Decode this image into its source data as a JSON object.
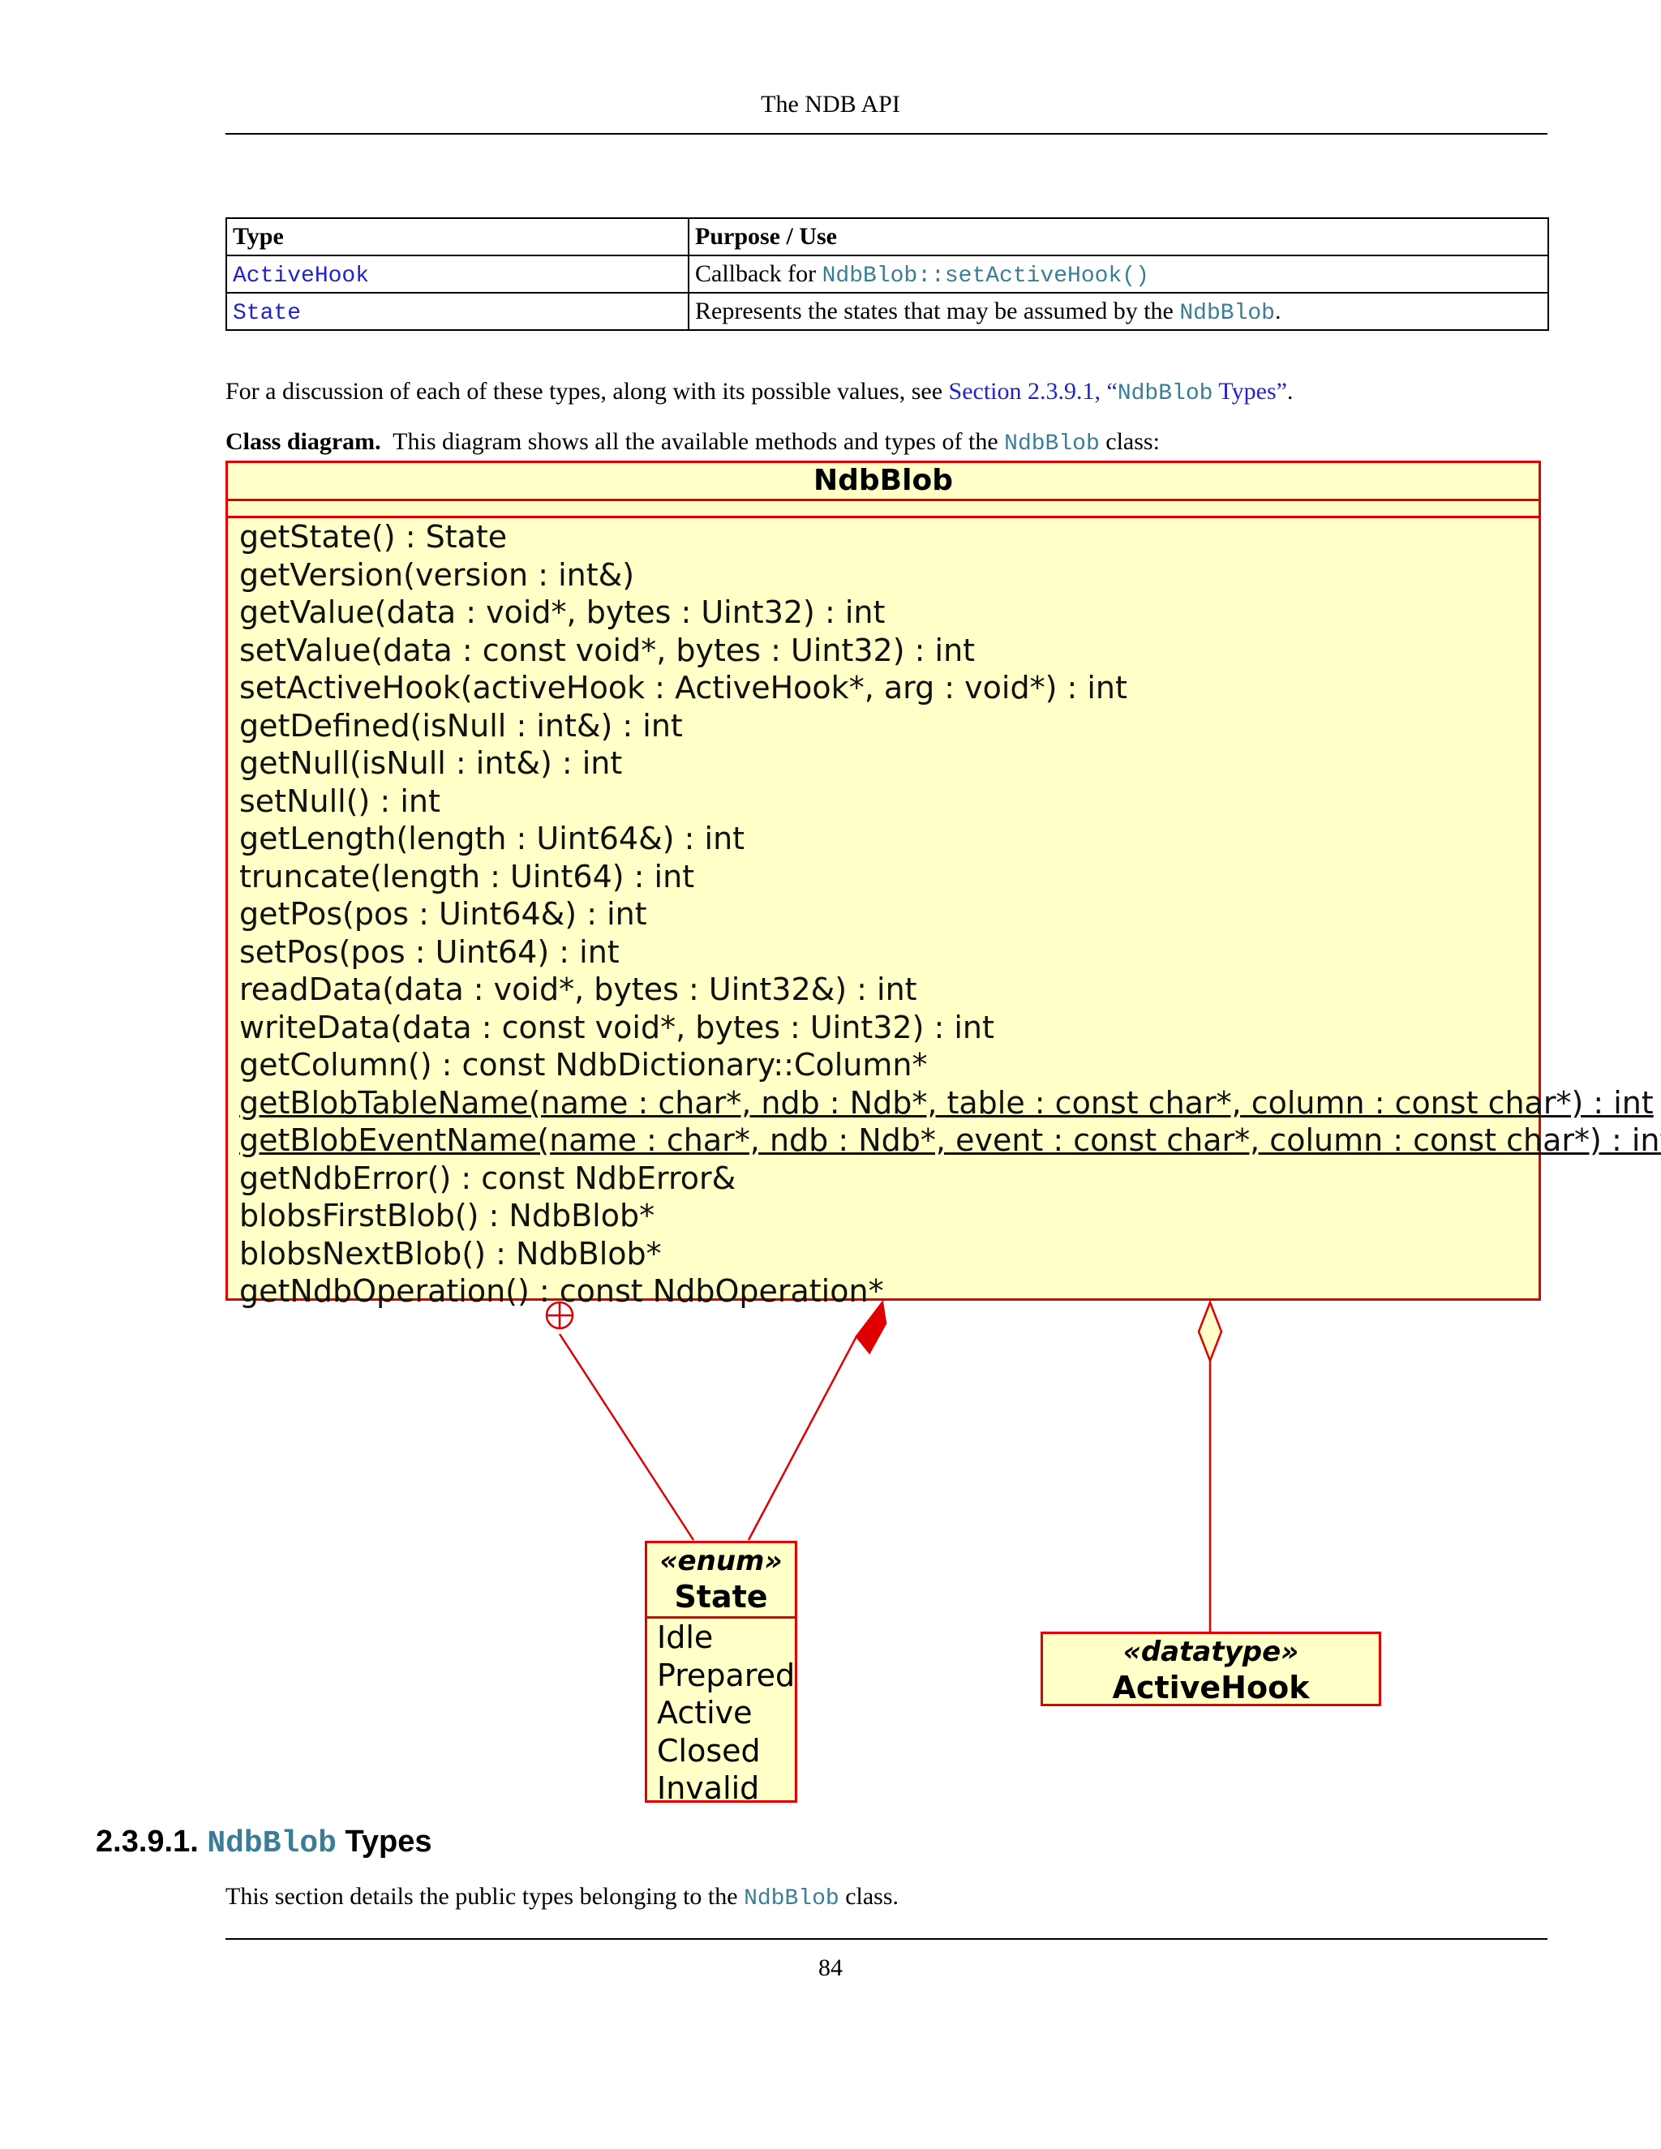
{
  "header": {
    "title": "The NDB API"
  },
  "types_table": {
    "headers": [
      "Type",
      "Purpose / Use"
    ],
    "rows": [
      {
        "type": "ActiveHook",
        "purpose_text": "Callback for ",
        "purpose_code": "NdbBlob::setActiveHook()",
        "purpose_tail": ""
      },
      {
        "type": "State",
        "purpose_text": "Represents the states that may be assumed by the ",
        "purpose_code": "NdbBlob",
        "purpose_tail": "."
      }
    ]
  },
  "discussion": {
    "text_before": "For a discussion of each of these types, along with its possible values, see ",
    "link_section": "Section 2.3.9.1, “",
    "link_code": "NdbBlob",
    "link_end": " Types”",
    "text_after": "."
  },
  "class_diagram_caption": {
    "label": "Class diagram.",
    "text": "This diagram shows all the available methods and types of the ",
    "code": "NdbBlob",
    "tail": " class:"
  },
  "uml": {
    "class_name": "NdbBlob",
    "methods": [
      {
        "text": "getState() : State",
        "static": false
      },
      {
        "text": "getVersion(version : int&)",
        "static": false
      },
      {
        "text": "getValue(data : void*, bytes : Uint32) : int",
        "static": false
      },
      {
        "text": "setValue(data : const void*, bytes : Uint32) : int",
        "static": false
      },
      {
        "text": "setActiveHook(activeHook : ActiveHook*, arg : void*) : int",
        "static": false
      },
      {
        "text": "getDefined(isNull : int&) : int",
        "static": false
      },
      {
        "text": "getNull(isNull : int&) : int",
        "static": false
      },
      {
        "text": "setNull() : int",
        "static": false
      },
      {
        "text": "getLength(length : Uint64&) : int",
        "static": false
      },
      {
        "text": "truncate(length : Uint64) : int",
        "static": false
      },
      {
        "text": "getPos(pos : Uint64&) : int",
        "static": false
      },
      {
        "text": "setPos(pos : Uint64) : int",
        "static": false
      },
      {
        "text": "readData(data : void*, bytes : Uint32&) : int",
        "static": false
      },
      {
        "text": "writeData(data : const void*, bytes : Uint32) : int",
        "static": false
      },
      {
        "text": "getColumn() : const NdbDictionary::Column*",
        "static": false
      },
      {
        "text": "getBlobTableName(name : char*, ndb : Ndb*, table : const char*, column : const char*) : int",
        "static": true
      },
      {
        "text": "getBlobEventName(name : char*, ndb : Ndb*, event : const char*, column : const char*) : int",
        "static": true
      },
      {
        "text": "getNdbError() : const NdbError&",
        "static": false
      },
      {
        "text": "blobsFirstBlob() : NdbBlob*",
        "static": false
      },
      {
        "text": "blobsNextBlob() : NdbBlob*",
        "static": false
      },
      {
        "text": "getNdbOperation() : const NdbOperation*",
        "static": false
      }
    ],
    "enum_box": {
      "stereotype": "«enum»",
      "name": "State",
      "values": [
        "Idle",
        "Prepared",
        "Active",
        "Closed",
        "Invalid"
      ]
    },
    "datatype_box": {
      "stereotype": "«datatype»",
      "name": "ActiveHook"
    },
    "colors": {
      "border": "#e00000",
      "fill": "#ffffc8"
    }
  },
  "section": {
    "number": "2.3.9.1.",
    "code": "NdbBlob",
    "title": " Types",
    "body_text": "This section details the public types belonging to the ",
    "body_code": "NdbBlob",
    "body_tail": " class."
  },
  "footer": {
    "page_number": "84"
  }
}
